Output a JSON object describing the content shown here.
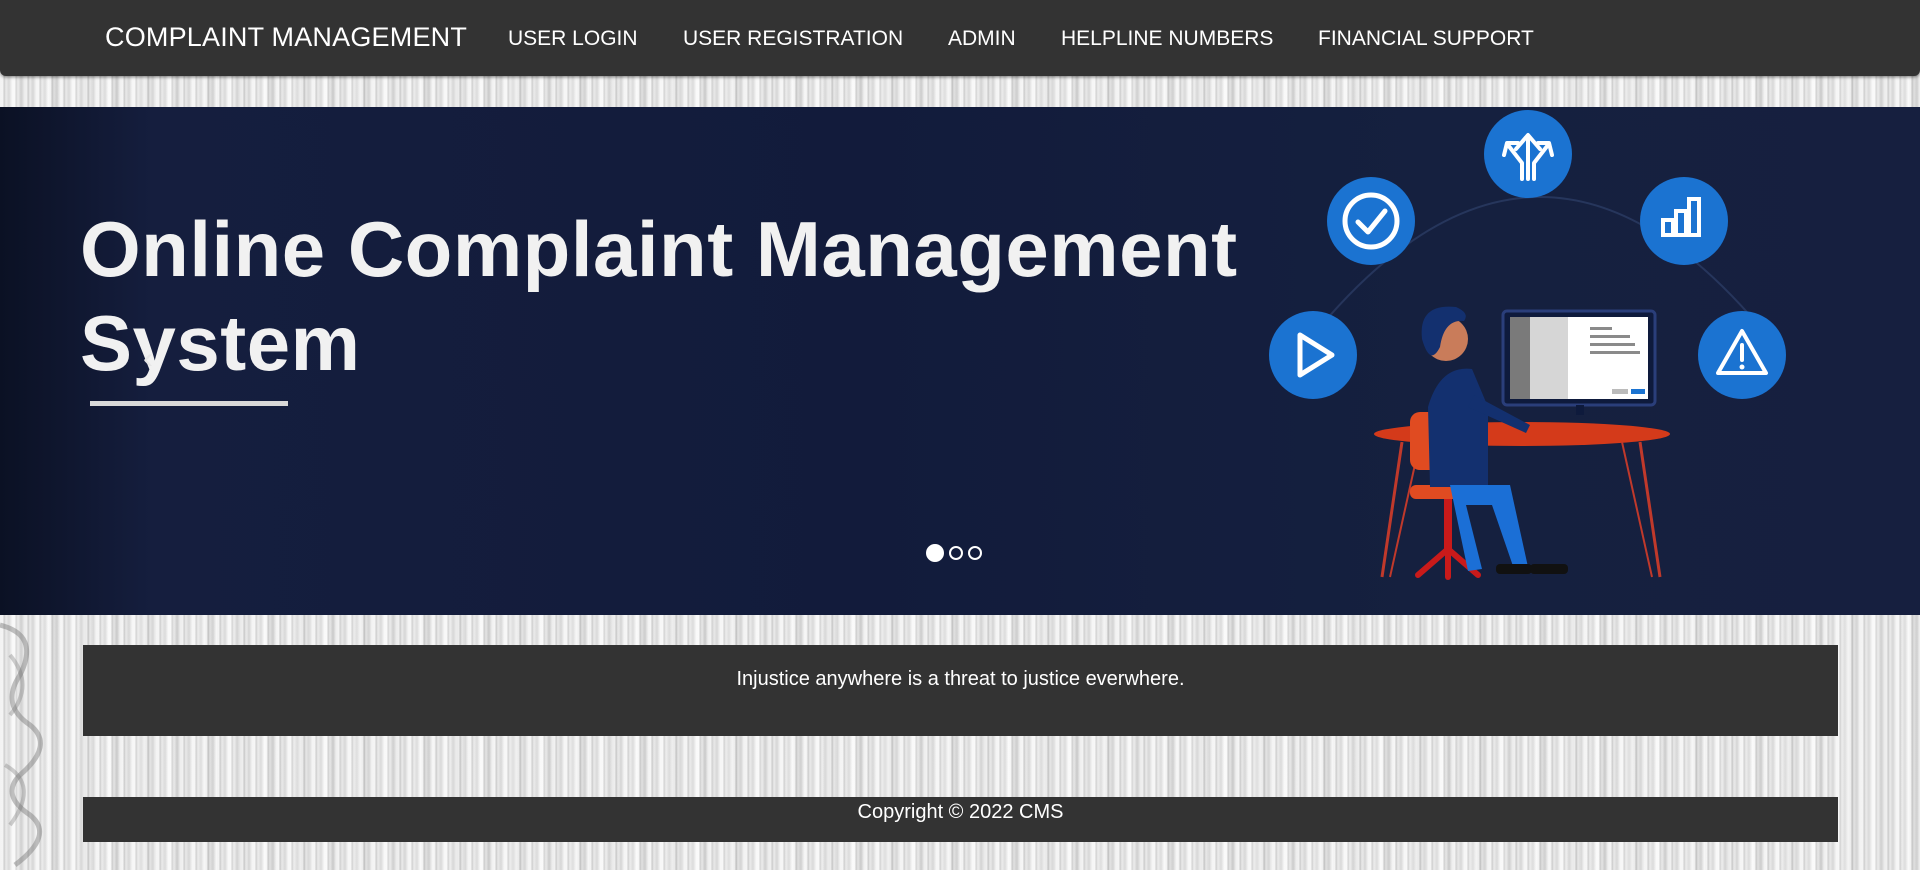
{
  "navbar": {
    "brand": "COMPLAINT MANAGEMENT",
    "items": [
      {
        "label": "USER LOGIN"
      },
      {
        "label": "USER REGISTRATION"
      },
      {
        "label": "ADMIN"
      },
      {
        "label": "HELPLINE NUMBERS"
      },
      {
        "label": "FINANCIAL SUPPORT"
      }
    ]
  },
  "hero": {
    "title_line1": "Online Complaint Management",
    "title_line2": "System",
    "prev_arrow": "‹",
    "next_arrow": "›",
    "slide_count": 3,
    "active_slide": 1,
    "icons": [
      "check-circle-icon",
      "split-arrows-icon",
      "bar-chart-icon",
      "play-icon",
      "warning-icon"
    ]
  },
  "quote": {
    "text": "Injustice anywhere is a threat to justice everwhere."
  },
  "footer": {
    "copyright": "Copyright © 2022 CMS"
  },
  "colors": {
    "navbar_bg": "#333333",
    "hero_bg": "#141d3d",
    "icon_blue": "#1b73d1",
    "box_bg": "#333333"
  }
}
